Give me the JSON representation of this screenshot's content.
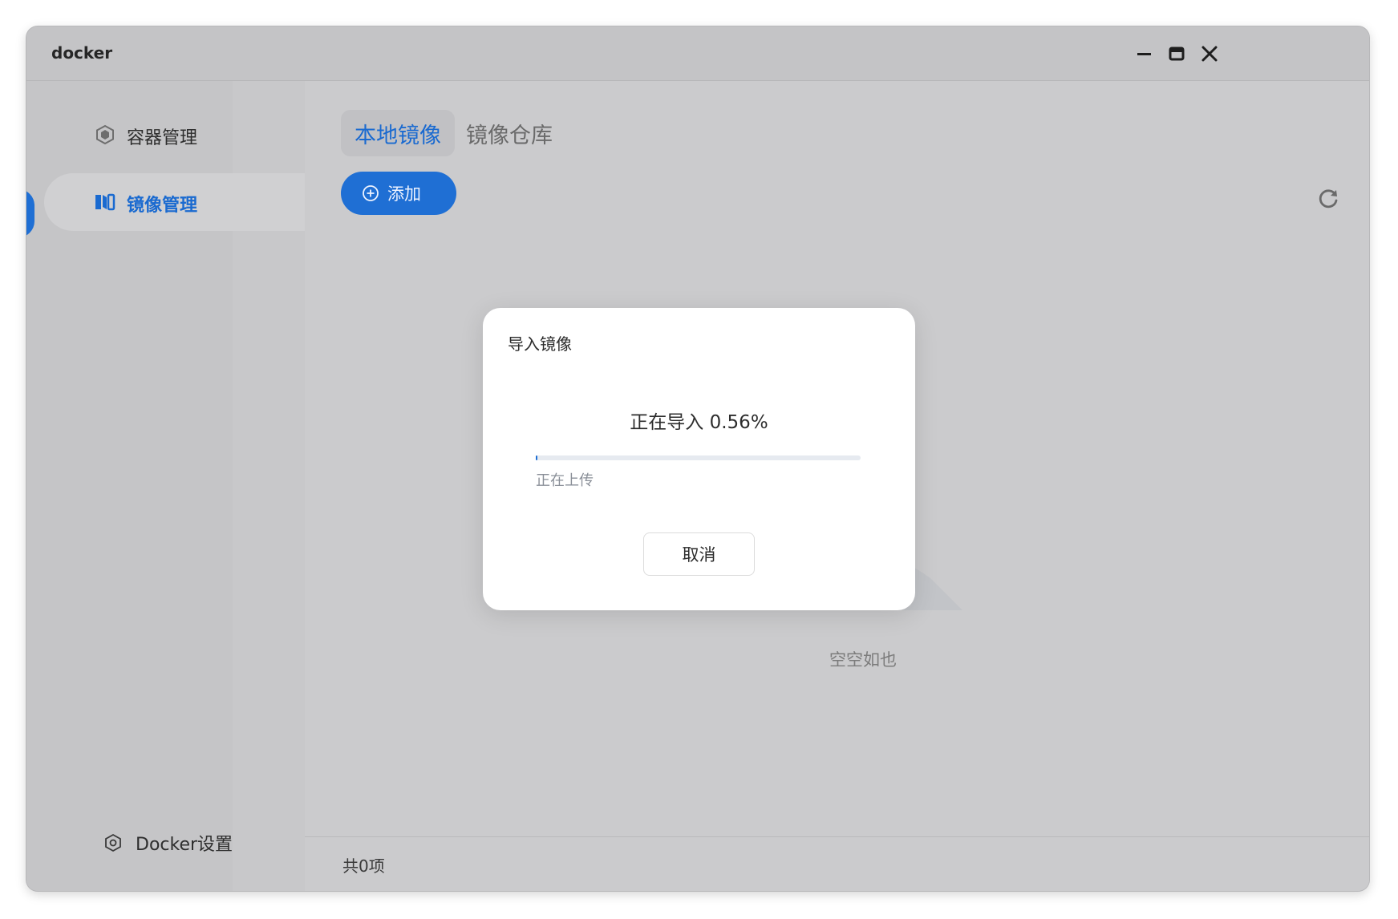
{
  "window": {
    "title": "docker"
  },
  "sidebar": {
    "items": [
      {
        "label": "容器管理",
        "icon": "container-icon",
        "active": false
      },
      {
        "label": "镜像管理",
        "icon": "image-icon",
        "active": true
      }
    ],
    "settings_label": "Docker设置"
  },
  "main": {
    "tabs": [
      {
        "label": "本地镜像",
        "active": true
      },
      {
        "label": "镜像仓库",
        "active": false
      }
    ],
    "add_button_label": "添加",
    "empty_text": "空空如也",
    "footer_count": "共0项"
  },
  "dialog": {
    "title": "导入镜像",
    "status": "正在导入 0.56%",
    "progress_percent": 0.56,
    "sub_status": "正在上传",
    "cancel_label": "取消"
  },
  "colors": {
    "accent": "#1f6fd4",
    "overlay": "#c9c9ca",
    "dialog_bg": "#ffffff"
  }
}
